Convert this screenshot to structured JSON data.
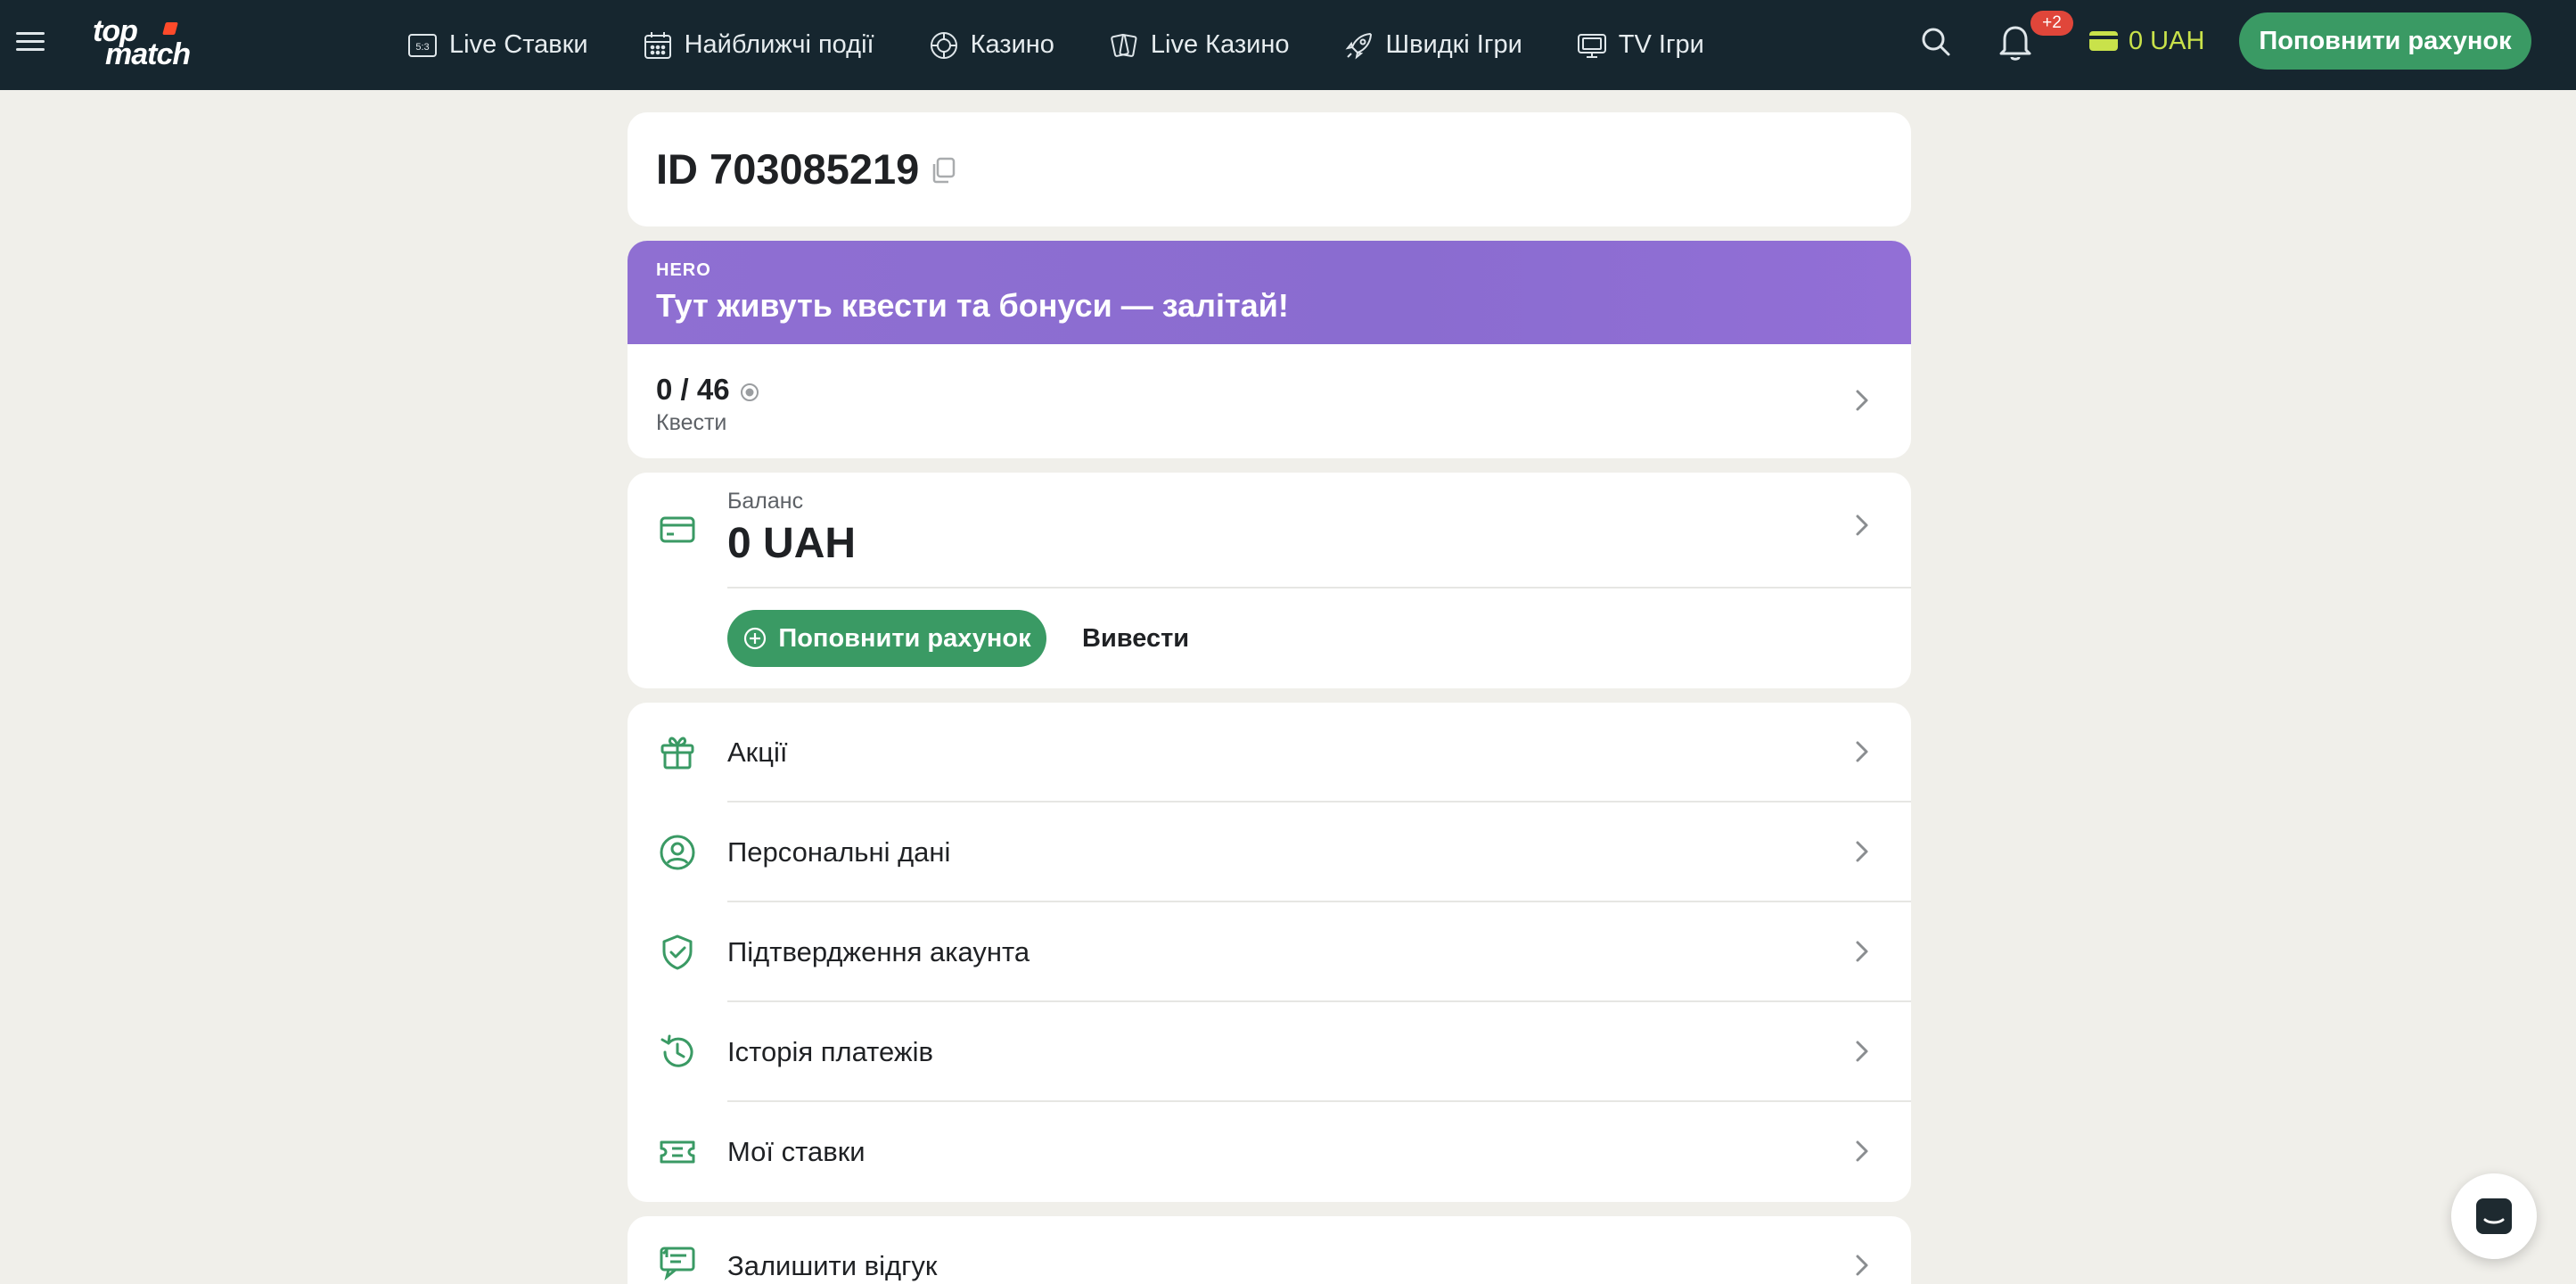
{
  "header": {
    "logo_line1": "top",
    "logo_line2": "match",
    "nav": [
      {
        "label": "Live Ставки",
        "icon": "scoreboard-icon"
      },
      {
        "label": "Найближчі події",
        "icon": "calendar-icon"
      },
      {
        "label": "Казино",
        "icon": "casino-chip-icon"
      },
      {
        "label": "Live Казино",
        "icon": "playing-cards-icon"
      },
      {
        "label": "Швидкі Ігри",
        "icon": "rocket-icon"
      },
      {
        "label": "TV Ігри",
        "icon": "tv-icon"
      }
    ],
    "notifications_badge": "+2",
    "balance": "0 UAH",
    "deposit_label": "Поповнити рахунок"
  },
  "account": {
    "id_text": "ID 703085219"
  },
  "hero": {
    "label": "HERO",
    "title": "Тут живуть квести та бонуси — залітай!",
    "quests_count": "0 / 46",
    "quests_label": "Квести"
  },
  "balance": {
    "label": "Баланс",
    "value": "0 UAH",
    "deposit_label": "Поповнити рахунок",
    "withdraw_label": "Вивести"
  },
  "menu": [
    {
      "label": "Акції",
      "icon": "gift-icon"
    },
    {
      "label": "Персональні дані",
      "icon": "user-circle-icon"
    },
    {
      "label": "Підтвердження акаунта",
      "icon": "shield-check-icon"
    },
    {
      "label": "Історія платежів",
      "icon": "history-icon"
    },
    {
      "label": "Мої ставки",
      "icon": "ticket-icon"
    }
  ],
  "feedback": {
    "label": "Залишити відгук",
    "icon": "feedback-icon"
  },
  "colors": {
    "header_bg": "#16262f",
    "accent_green": "#3a9a64",
    "hero_purple": "#8a6cd0",
    "balance_yellow": "#c9e24a",
    "badge_red": "#e0463a"
  }
}
